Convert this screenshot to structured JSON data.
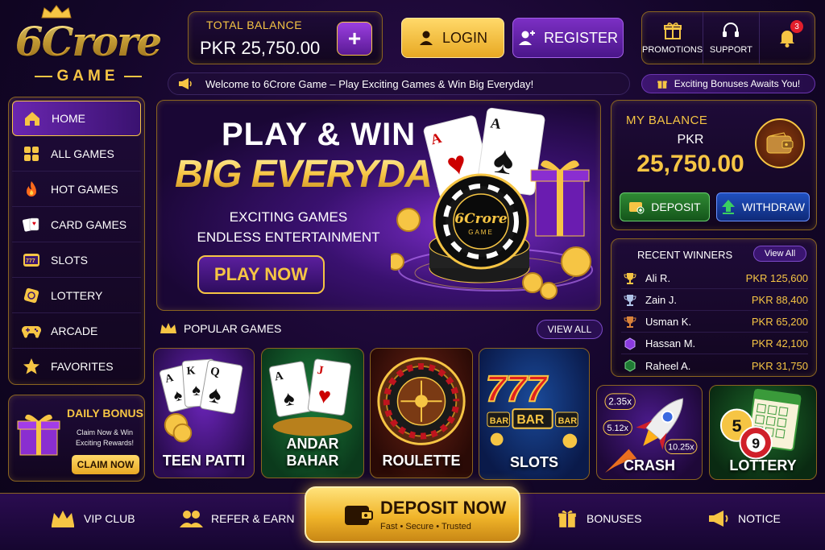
{
  "brand": {
    "logo_text": "6Crore",
    "logo_sub": "GAME"
  },
  "header": {
    "balance_label": "TOTAL BALANCE",
    "balance_value": "PKR 25,750.00",
    "add_label": "+",
    "login_label": "LOGIN",
    "register_label": "REGISTER",
    "icons": [
      {
        "label": "PROMOTIONS",
        "icon": "gift-icon"
      },
      {
        "label": "SUPPORT",
        "icon": "headset-icon"
      },
      {
        "label": "",
        "icon": "bell-icon",
        "badge": "3"
      }
    ]
  },
  "ticker": {
    "text": "Welcome to 6Crore Game – Play Exciting Games & Win Big Everyday!",
    "bonus_text": "Exciting Bonuses Awaits You!"
  },
  "sidebar": {
    "items": [
      {
        "label": "HOME",
        "icon": "home-icon"
      },
      {
        "label": "ALL GAMES",
        "icon": "grid-icon"
      },
      {
        "label": "HOT GAMES",
        "icon": "fire-icon"
      },
      {
        "label": "CARD GAMES",
        "icon": "cards-icon"
      },
      {
        "label": "SLOTS",
        "icon": "slots-icon"
      },
      {
        "label": "LOTTERY",
        "icon": "ticket-icon"
      },
      {
        "label": "ARCADE",
        "icon": "gamepad-icon"
      },
      {
        "label": "FAVORITES",
        "icon": "star-icon"
      }
    ]
  },
  "daily_bonus": {
    "title": "DAILY BONUS",
    "desc": "Claim Now & Win Exciting Rewards!",
    "button": "CLAIM NOW"
  },
  "hero": {
    "line1": "PLAY & WIN",
    "line2": "BIG EVERYDAY",
    "line3": "EXCITING GAMES",
    "line4": "ENDLESS ENTERTAINMENT",
    "button": "PLAY NOW",
    "chip_text": "6Crore",
    "chip_sub": "GAME"
  },
  "my_balance": {
    "title": "MY BALANCE",
    "currency": "PKR",
    "amount": "25,750.00",
    "deposit": "DEPOSIT",
    "withdraw": "WITHDRAW"
  },
  "winners": {
    "title": "RECENT WINNERS",
    "view_all": "View All",
    "rows": [
      {
        "name": "Ali R.",
        "amount": "PKR 125,600",
        "medal": "trophy-gold-icon"
      },
      {
        "name": "Zain J.",
        "amount": "PKR 88,400",
        "medal": "trophy-silver-icon"
      },
      {
        "name": "Usman K.",
        "amount": "PKR 65,200",
        "medal": "trophy-bronze-icon"
      },
      {
        "name": "Hassan M.",
        "amount": "PKR 42,100",
        "medal": "badge-purple-icon"
      },
      {
        "name": "Raheel A.",
        "amount": "PKR 31,750",
        "medal": "badge-green-icon"
      }
    ]
  },
  "popular": {
    "title": "POPULAR GAMES",
    "view_all": "VIEW ALL",
    "games": [
      {
        "name": "TEEN PATTI"
      },
      {
        "name": "ANDAR BAHAR"
      },
      {
        "name": "ROULETTE"
      },
      {
        "name": "SLOTS"
      },
      {
        "name": "CRASH",
        "multipliers": [
          "2.35x",
          "5.12x",
          "10.25x"
        ]
      },
      {
        "name": "LOTTERY"
      }
    ]
  },
  "bottom_bar": {
    "vip": "VIP CLUB",
    "refer": "REFER & EARN",
    "deposit_now": "DEPOSIT NOW",
    "deposit_sub": "Fast • Secure • Trusted",
    "bonuses": "BONUSES",
    "notice": "NOTICE"
  },
  "colors": {
    "gold": "#f6c544",
    "purple": "#5a1a95",
    "bg": "#14062a"
  }
}
